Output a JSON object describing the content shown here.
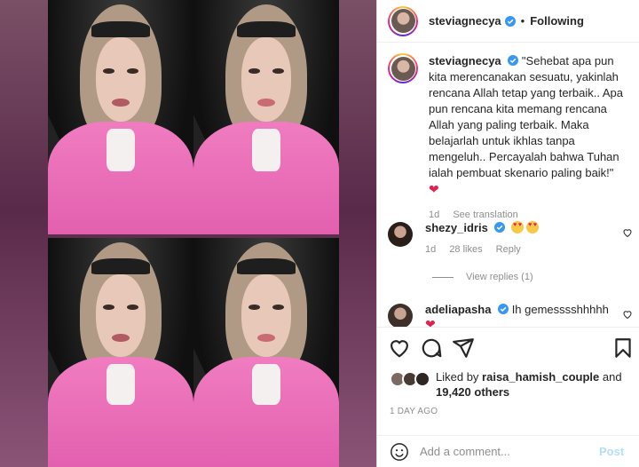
{
  "post": {
    "username": "steviagnecya",
    "dot": "•",
    "follow_status": "Following"
  },
  "caption": {
    "username": "steviagnecya",
    "text": "\"Sehebat apa pun kita merencanakan sesuatu, yakinlah rencana Allah tetap yang terbaik.. Apa pun rencana kita memang rencana Allah yang paling terbaik. Maka belajarlah untuk ikhlas tanpa mengeluh.. Percayalah bahwa Tuhan ialah pembuat skenario paling baik!\"",
    "emoji": "❤",
    "age": "1d",
    "see_translation": "See translation"
  },
  "comments": [
    {
      "username": "shezy_idris",
      "text": "",
      "age": "1d",
      "likes": "28 likes",
      "reply": "Reply"
    },
    {
      "username": "adeliapasha",
      "text": "Ih gemesssshhhhh"
    }
  ],
  "view_replies": "View replies (1)",
  "likes": {
    "prefix": "Liked by",
    "user": "raisa_hamish_couple",
    "conj": "and",
    "others": "19,420 others"
  },
  "timestamp": "1 DAY AGO",
  "composer": {
    "placeholder": "Add a comment...",
    "post_label": "Post"
  },
  "icons": [
    "verified-badge-icon",
    "heart-icon",
    "comment-icon",
    "share-icon",
    "bookmark-icon",
    "emoji-icon"
  ],
  "colors": {
    "verified": "#3897f0",
    "post_disabled": "#b2dffc",
    "heart": "#e0234e",
    "jacket": "#f07cc0"
  }
}
